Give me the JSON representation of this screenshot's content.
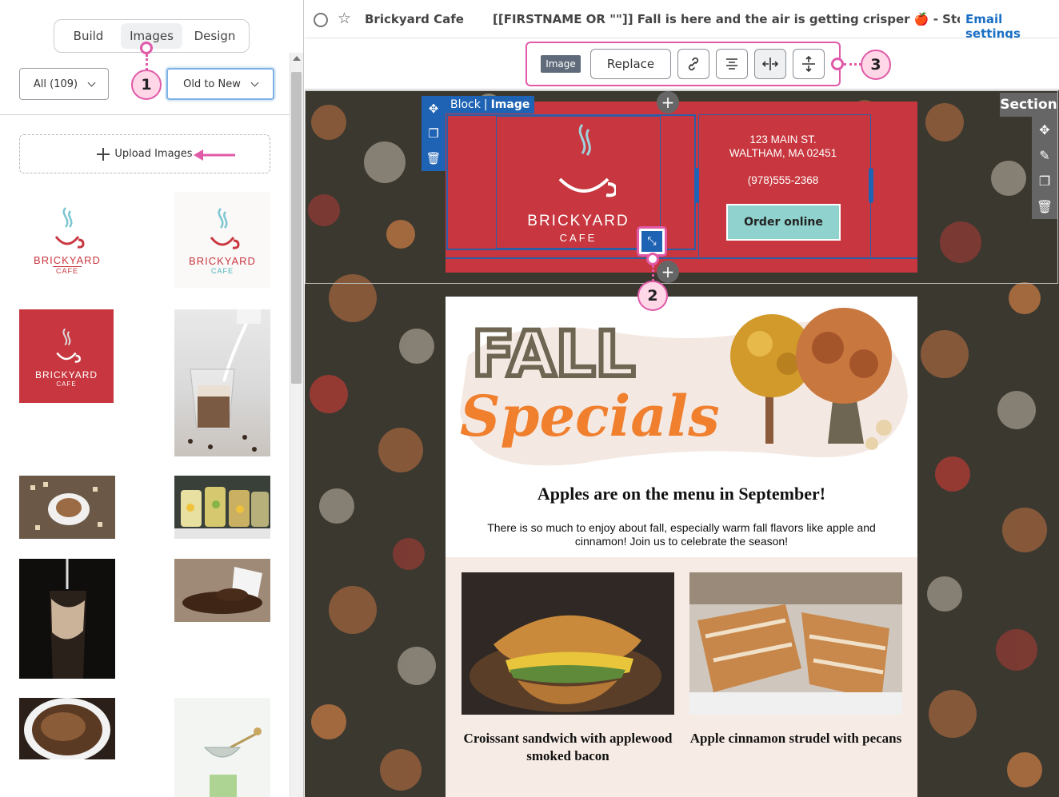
{
  "left_panel": {
    "tabs": [
      "Build",
      "Images",
      "Design"
    ],
    "active_tab": "Images",
    "filter_label": "All (109)",
    "sort_label": "Old to New",
    "upload_label": "Upload Images",
    "thumbnails": [
      {
        "name": "BRICKYARD",
        "sub": "CAFE",
        "variant": "logo-red"
      },
      {
        "name": "BRICKYARD",
        "sub": "CAFE",
        "variant": "logo-teal"
      },
      {
        "name": "BRICKYARD",
        "sub": "CAFE",
        "variant": "logo-on-red"
      },
      {
        "variant": "photo-milk-pour"
      },
      {
        "variant": "photo-latte-letters"
      },
      {
        "variant": "photo-lemonade-jars"
      },
      {
        "variant": "photo-iced-coffee"
      },
      {
        "variant": "photo-coffee-beans-cup"
      },
      {
        "variant": "photo-espresso"
      },
      {
        "variant": "photo-matcha-sieve"
      }
    ]
  },
  "topbar": {
    "sender": "Brickyard Cafe",
    "subject": "[[FIRSTNAME OR \"\"]] Fall is here and the air is getting crisper 🍎 - Stop on b…",
    "settings_link": "Email settings"
  },
  "toolbar": {
    "badge": "Image",
    "replace_label": "Replace",
    "icons": [
      "link-icon",
      "align-center-icon",
      "full-width-icon",
      "padding-icon"
    ]
  },
  "callouts": [
    "1",
    "2",
    "3"
  ],
  "canvas": {
    "section_label": "Section",
    "block_label": "Block",
    "block_type": "Image",
    "logo": {
      "name": "BRICKYARD",
      "sub": "CAFE"
    },
    "address_line1": "123 MAIN ST.",
    "address_line2": "WALTHAM, MA 02451",
    "phone": "(978)555-2368",
    "order_label": "Order online",
    "banner_fall": "FALL",
    "banner_specials": "Specials",
    "headline": "Apples are on the menu in September!",
    "body": "There is so much to enjoy about fall, especially warm fall flavors like apple and cinnamon! Join us to celebrate the season!",
    "items": [
      {
        "caption": "Croissant sandwich with applewood smoked bacon"
      },
      {
        "caption": "Apple cinnamon strudel with pecans"
      }
    ]
  },
  "colors": {
    "brand_red": "#c8373f",
    "teal": "#8fd2ce",
    "accent_pink": "#e05aa8",
    "select_blue": "#1f63b5",
    "link_blue": "#1a6fc4"
  }
}
